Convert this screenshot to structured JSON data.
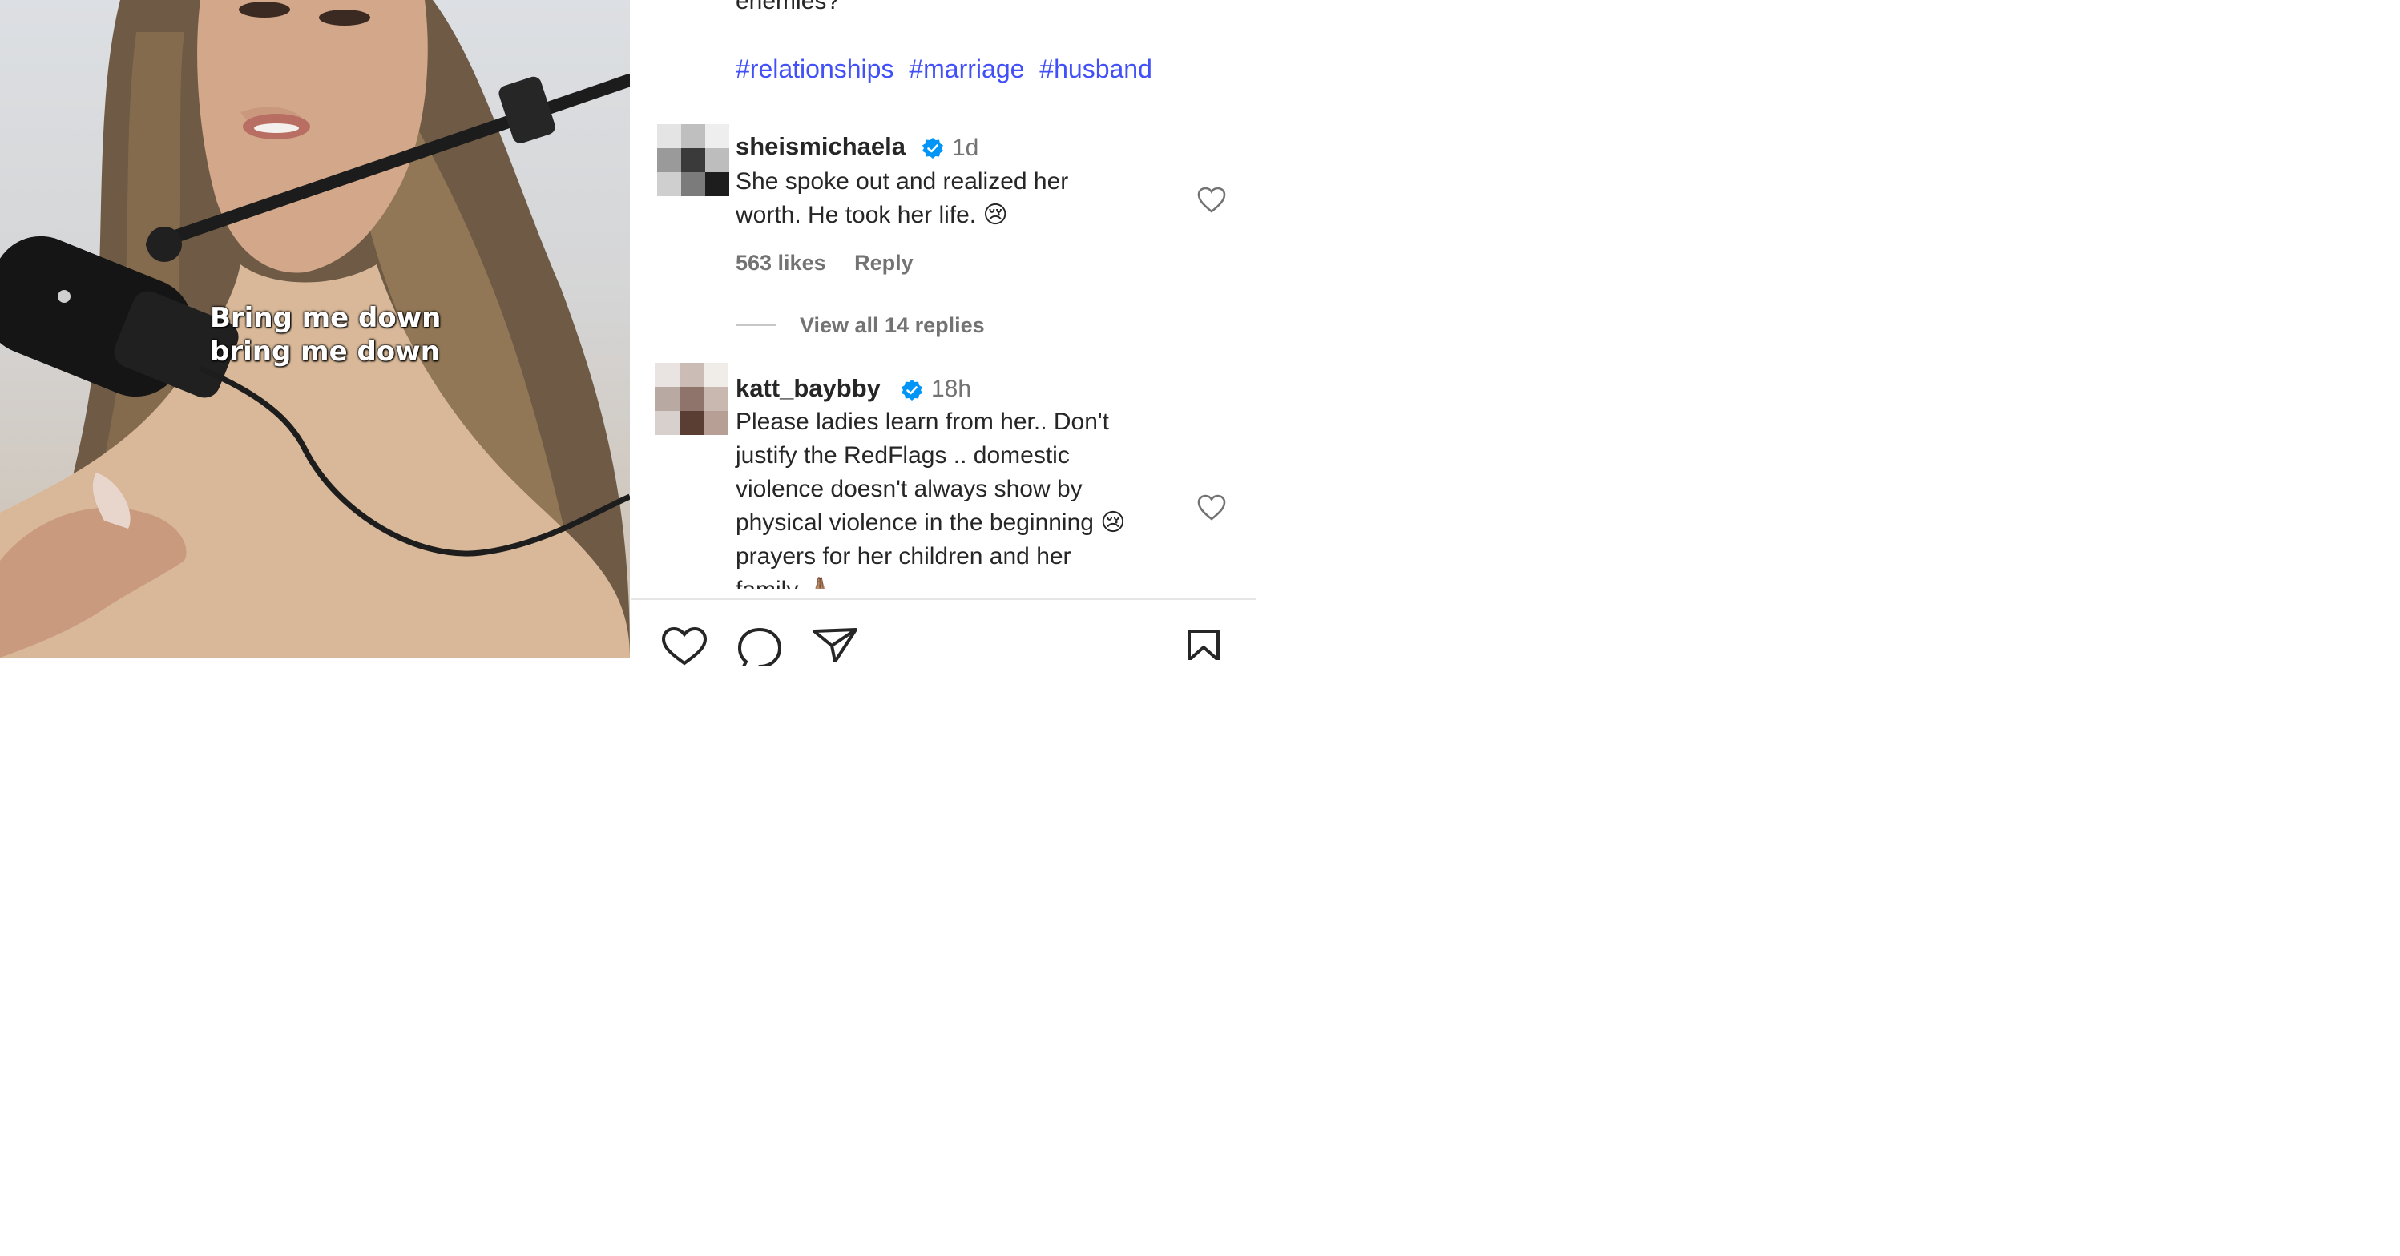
{
  "video": {
    "caption_lines": [
      "Bring me down",
      "bring me down"
    ]
  },
  "post": {
    "text_fragment": "enemies?",
    "hashtags": [
      "#relationships",
      "#marriage",
      "#husband"
    ],
    "hashtag_color": "#4150f7"
  },
  "comments": [
    {
      "username": "sheismichaela",
      "verified": true,
      "time": "1d",
      "text_lines": [
        "She spoke out and realized her",
        "worth. He took her life. 😢"
      ],
      "likes": "563 likes",
      "reply_label": "Reply",
      "view_replies": "View all 14 replies"
    },
    {
      "username": "katt_baybby",
      "verified": true,
      "time": "18h",
      "text_lines": [
        "Please ladies learn from her.. Don't",
        "justify the RedFlags .. domestic",
        "violence doesn't always show by",
        "physical violence in the beginning 😢",
        "prayers for her children and her",
        "family 🙏🏽"
      ]
    }
  ],
  "icons": {
    "like": "heart-icon",
    "comment": "comment-icon",
    "share": "send-icon",
    "save": "bookmark-icon",
    "verified": "verified-badge-icon"
  },
  "colors": {
    "verified_blue": "#0095f6",
    "muted_text": "#737373"
  }
}
